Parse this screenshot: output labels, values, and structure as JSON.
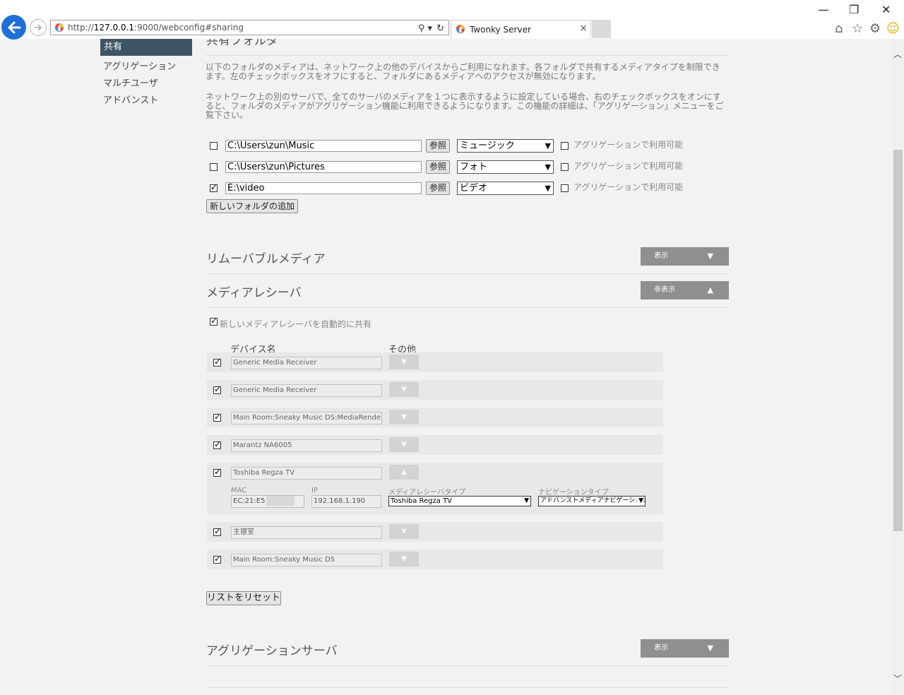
{
  "browser": {
    "url_prefix": "http://",
    "url_host": "127.0.0.1",
    "url_rest": ":9000/webconfig#sharing",
    "tab_title": "Twonky Server",
    "tab_close": "×",
    "search_glyph": "⚲ ▾",
    "refresh_glyph": "↻",
    "minimize": "—",
    "restore": "❐",
    "close": "✕"
  },
  "sidebar": {
    "active": "共有",
    "items": [
      "アグリゲーション",
      "マルチユーザ",
      "アドバンスト"
    ]
  },
  "shared_folders": {
    "title_partial": "共有フォルダ",
    "para1": "以下のフォルダのメディアは、ネットワーク上の他のデバイスからご利用になれます。各フォルダで共有するメディアタイプを制限できます。左のチェックボックスをオフにすると、フォルダにあるメディアへのアクセスが無効になります。",
    "para2": "ネットワーク上の別のサーバで、全てのサーバのメディアを１つに表示するように設定している場合、右のチェックボックスをオンにすると、フォルダのメディアがアグリゲーション機能に利用できるようになります。この機能の詳細は、「アグリゲーション」メニューをご覧下さい。",
    "browse_label": "参照",
    "agg_label": "アグリゲーションで利用可能",
    "add_folder_label": "新しいフォルダの追加",
    "folders": [
      {
        "path": "C:\\Users\\zun\\Music",
        "type": "ミュージック",
        "checked": false
      },
      {
        "path": "C:\\Users\\zun\\Pictures",
        "type": "フォト",
        "checked": false
      },
      {
        "path": "E:\\video",
        "type": "ビデオ",
        "checked": true
      }
    ]
  },
  "removable": {
    "title": "リムーバブルメディア",
    "toggle_label": "表示",
    "toggle_arrow": "▼"
  },
  "receivers": {
    "title": "メディアレシーバ",
    "toggle_label": "非表示",
    "toggle_arrow": "▲",
    "auto_share_label": "新しいメディアレシーバを自動的に共有",
    "col_device": "デバイス名",
    "col_other": "その他",
    "drop_arrow_down": "▼",
    "drop_arrow_up": "▲",
    "devices": [
      "Generic Media Receiver",
      "Generic Media Receiver",
      "Main Room:Sneaky Music DS:MediaRenderer",
      "Marantz NA6005",
      "Toshiba Regza TV",
      "主寝室",
      "Main Room:Sneaky Music DS"
    ],
    "expanded": {
      "mac_label": "MAC",
      "mac_value": "EC:21:E5",
      "ip_label": "IP",
      "ip_value": "192.168.1.190",
      "receiver_type_label": "メディアレシーバタイプ",
      "receiver_type_value": "Toshiba Regza TV",
      "nav_type_label": "ナビゲーションタイプ",
      "nav_type_value": "アドバンストメディアナビゲーション"
    },
    "reset_label": "リストをリセット"
  },
  "aggregation_server": {
    "title": "アグリゲーションサーバ",
    "toggle_label": "表示",
    "toggle_arrow": "▼"
  },
  "colors": {
    "sidebar_active_bg": "#3d5464",
    "toggle_bg": "#8f8f8f",
    "back_button": "#1f6fd6"
  }
}
